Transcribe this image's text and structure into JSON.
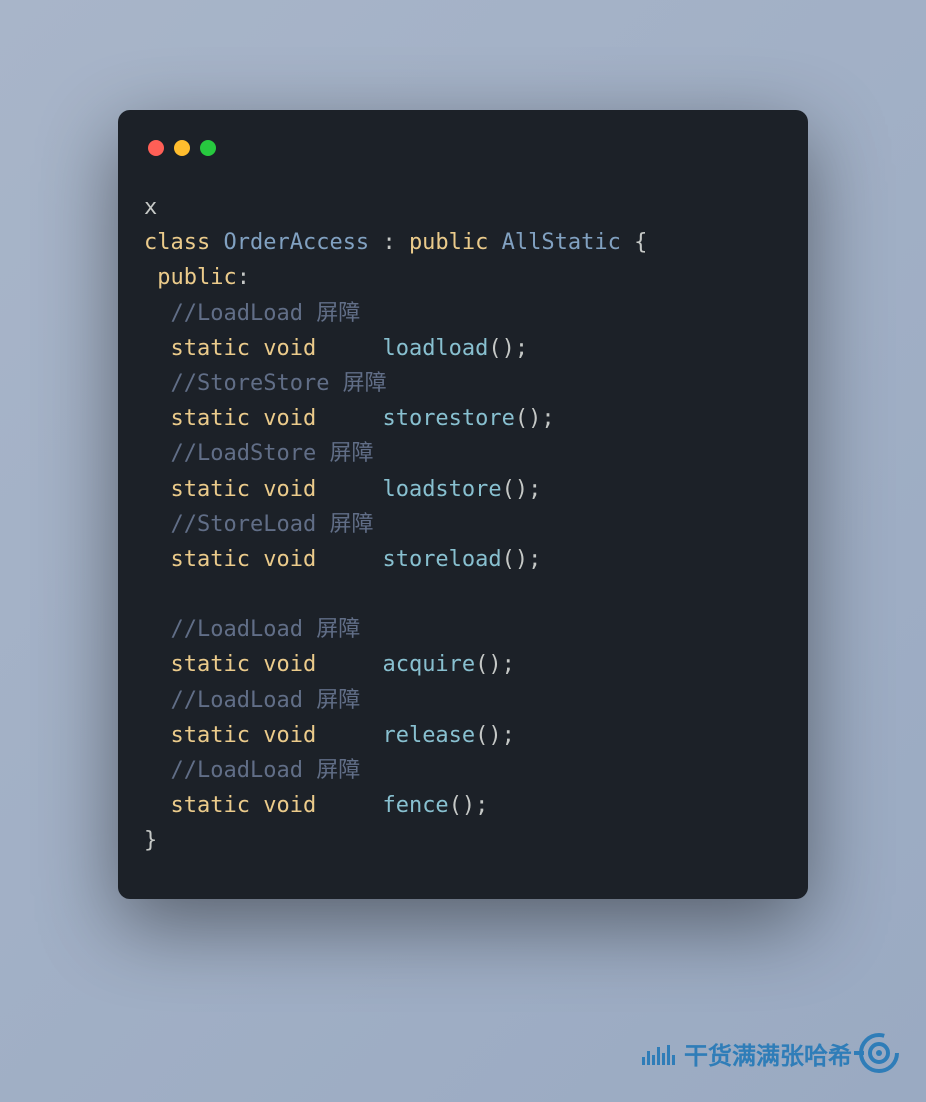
{
  "code": {
    "line1": "x",
    "keywords": {
      "class": "class",
      "public": "public",
      "static": "static",
      "void": "void"
    },
    "class_name": "OrderAccess",
    "parent_class": "AllStatic",
    "access_label": "public",
    "comments": {
      "loadload": "//LoadLoad 屏障",
      "storestore": "//StoreStore 屏障",
      "loadstore": "//LoadStore 屏障",
      "storeload": "//StoreLoad 屏障",
      "acquire": "//LoadLoad 屏障",
      "release": "//LoadLoad 屏障",
      "fence": "//LoadLoad 屏障"
    },
    "functions": {
      "loadload": "loadload",
      "storestore": "storestore",
      "loadstore": "loadstore",
      "storeload": "storeload",
      "acquire": "acquire",
      "release": "release",
      "fence": "fence"
    },
    "punct": {
      "colon": ":",
      "brace_open": "{",
      "brace_close": "}",
      "call": "();"
    }
  },
  "watermark": {
    "text": "干货满满张哈希"
  }
}
